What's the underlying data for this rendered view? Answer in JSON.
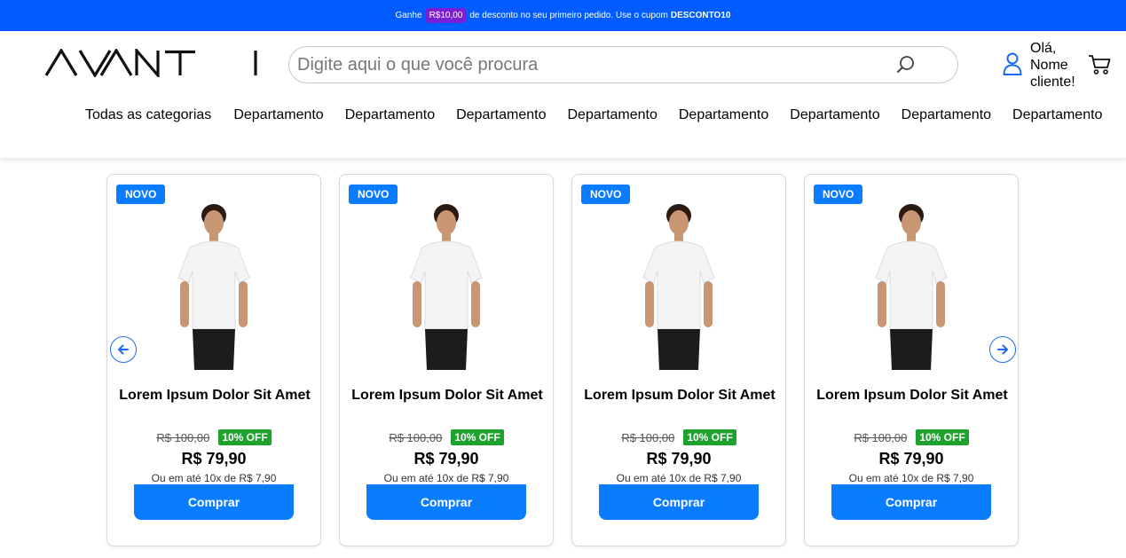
{
  "promo": {
    "prefix": "Ganhe",
    "amount": "R$10,00",
    "middle": "de desconto no seu primeiro pedido. Use o cupom",
    "coupon": "DESCONTO10"
  },
  "header": {
    "logo_text": "AVANTI",
    "search_placeholder": "Digite aqui o que você procura",
    "greeting": "Olá, Nome cliente!"
  },
  "nav": {
    "items": [
      {
        "label": "Todas as categorias"
      },
      {
        "label": "Departamento"
      },
      {
        "label": "Departamento"
      },
      {
        "label": "Departamento"
      },
      {
        "label": "Departamento"
      },
      {
        "label": "Departamento"
      },
      {
        "label": "Departamento"
      },
      {
        "label": "Departamento"
      },
      {
        "label": "Departamento"
      }
    ]
  },
  "carousel": {
    "stray_text": ";",
    "products": [
      {
        "badge": "NOVO",
        "title": "Lorem Ipsum Dolor Sit Amet",
        "old_price": "R$ 100,00",
        "discount": "10% OFF",
        "price": "R$ 79,90",
        "installments": "Ou em até 10x de R$ 7,90",
        "button": "Comprar"
      },
      {
        "badge": "NOVO",
        "title": "Lorem Ipsum Dolor Sit Amet",
        "old_price": "R$ 100,00",
        "discount": "10% OFF",
        "price": "R$ 79,90",
        "installments": "Ou em até 10x de R$ 7,90",
        "button": "Comprar"
      },
      {
        "badge": "NOVO",
        "title": "Lorem Ipsum Dolor Sit Amet",
        "old_price": "R$ 100,00",
        "discount": "10% OFF",
        "price": "R$ 79,90",
        "installments": "Ou em até 10x de R$ 7,90",
        "button": "Comprar"
      },
      {
        "badge": "NOVO",
        "title": "Lorem Ipsum Dolor Sit Amet",
        "old_price": "R$ 100,00",
        "discount": "10% OFF",
        "price": "R$ 79,90",
        "installments": "Ou em até 10x de R$ 7,90",
        "button": "Comprar"
      }
    ]
  },
  "colors": {
    "promo_bg": "#005cff",
    "promo_pill": "#7a1fd6",
    "accent": "#0a7cff",
    "discount": "#1fa12e"
  },
  "icons": [
    "search-icon",
    "user-icon",
    "cart-icon",
    "arrow-left-icon",
    "arrow-right-icon"
  ]
}
